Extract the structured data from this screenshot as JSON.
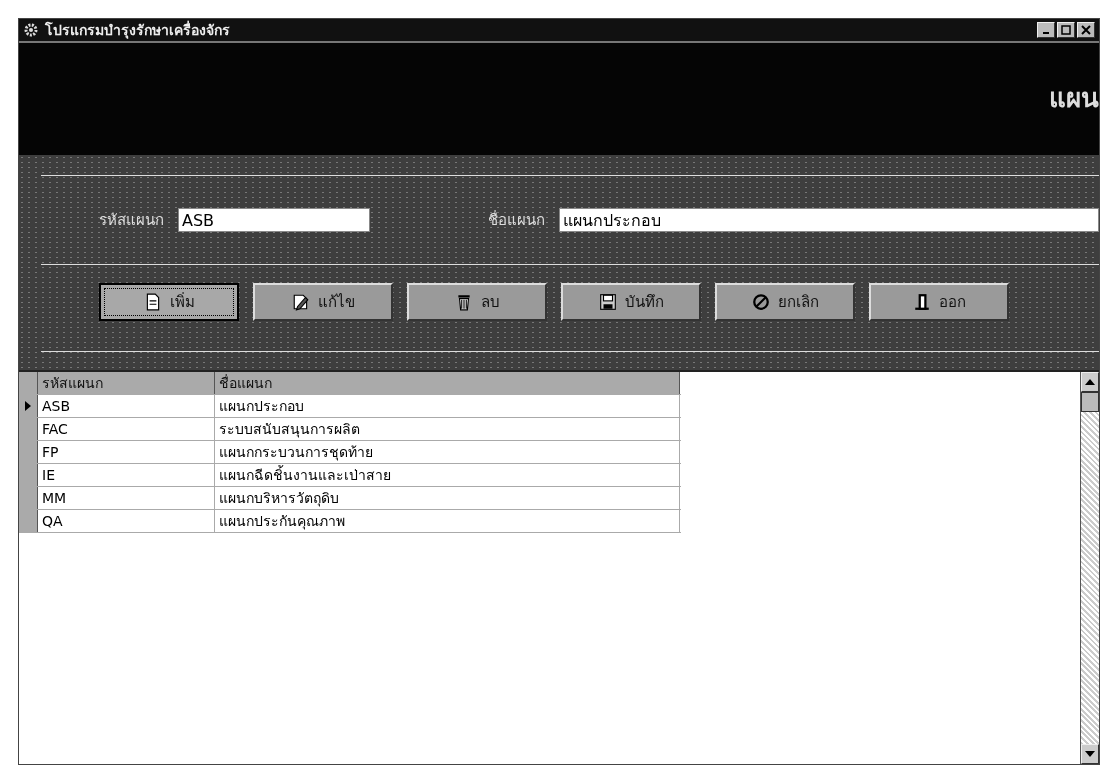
{
  "window": {
    "title": "โปรแกรมบำรุงรักษาเครื่องจักร"
  },
  "header": {
    "title": "แผน"
  },
  "form": {
    "fields": [
      {
        "label": "รหัสแผนก",
        "value": "ASB"
      },
      {
        "label": "ชื่อแผนก",
        "value": "แผนกประกอบ"
      }
    ]
  },
  "buttons": [
    {
      "label": "เพิ่ม",
      "kind": "add",
      "focused": true
    },
    {
      "label": "แก้ไข",
      "kind": "edit",
      "focused": false
    },
    {
      "label": "ลบ",
      "kind": "delete",
      "focused": false
    },
    {
      "label": "บันทึก",
      "kind": "save",
      "focused": false
    },
    {
      "label": "ยกเลิก",
      "kind": "cancel",
      "focused": false
    },
    {
      "label": "ออก",
      "kind": "exit",
      "focused": false
    }
  ],
  "table": {
    "columns": [
      "รหัสแผนก",
      "ชื่อแผนก"
    ],
    "rows": [
      {
        "cells": [
          "ASB",
          "แผนกประกอบ"
        ],
        "selected": true
      },
      {
        "cells": [
          "FAC",
          "ระบบสนับสนุนการผลิต"
        ],
        "selected": false
      },
      {
        "cells": [
          "FP",
          "แผนกกระบวนการชุดท้าย"
        ],
        "selected": false
      },
      {
        "cells": [
          "IE",
          "แผนกฉีดชิ้นงานและเป่าสาย"
        ],
        "selected": false
      },
      {
        "cells": [
          "MM",
          "แผนกบริหารวัตถุดิบ"
        ],
        "selected": false
      },
      {
        "cells": [
          "QA",
          "แผนกประกันคุณภาพ"
        ],
        "selected": false
      }
    ]
  }
}
